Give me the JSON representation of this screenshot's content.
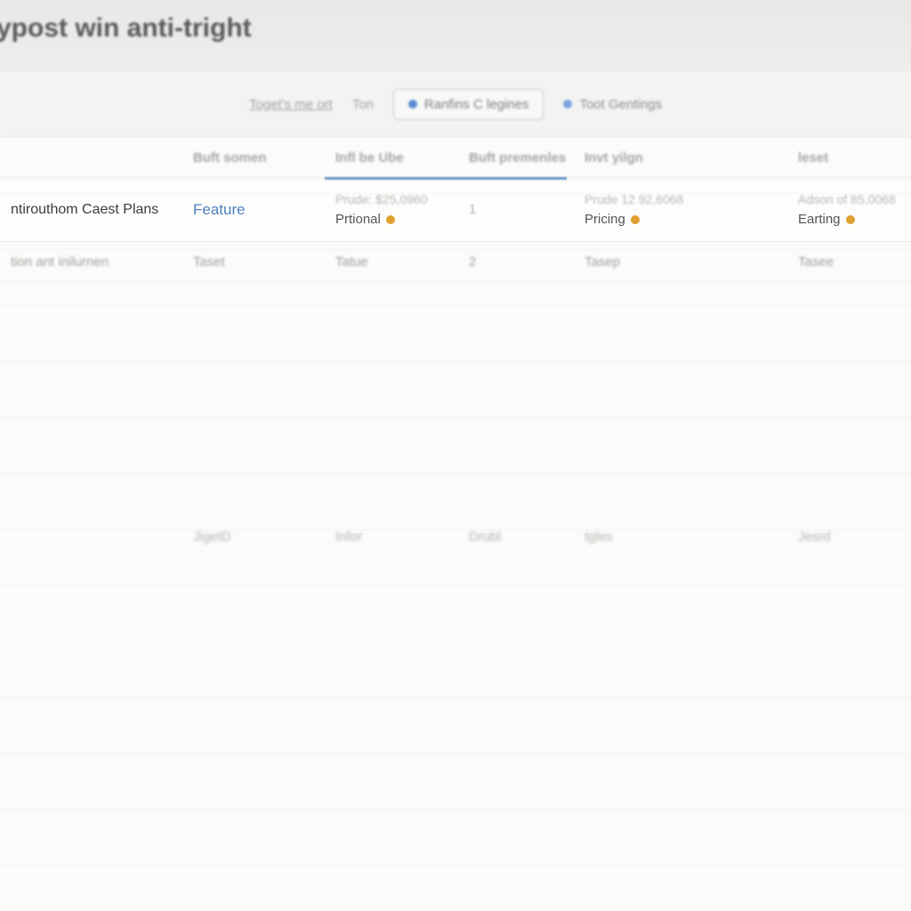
{
  "header": {
    "title": "ypost win anti-tright"
  },
  "toolbar": {
    "link1": "Toget's me ort",
    "link2": "Ton",
    "button_primary": "Ranfins C legines",
    "button_ghost": "Toot Gentings"
  },
  "columns": {
    "c0": "",
    "c1": "Buft somen",
    "c2": "Infl be Ube",
    "c3": "Buft premenles",
    "c4": "Invt yilgn",
    "c5": "leset"
  },
  "rows": {
    "main": {
      "title": "ntirouthom Caest Plans",
      "feature_link": "Feature",
      "col2_top": "Prude:  $25,0960",
      "col2_tag": "Prtional",
      "col3_num": "1",
      "col4_top": "Prude  12  92,6068",
      "col4_tag": "Pricing",
      "col5_top": "Adson of  85,0068",
      "col5_tag": "Earting"
    },
    "second": {
      "title": "tion ant inilurnen",
      "c1": "Taset",
      "c2": "Tatue",
      "c3": "2",
      "c4": "Tasep",
      "c5": "Tasee"
    },
    "faded": {
      "c1": "JigetD",
      "c2": "Infor",
      "c3": "Drubl",
      "c4": "tgles",
      "c5": "Jesrd"
    }
  }
}
